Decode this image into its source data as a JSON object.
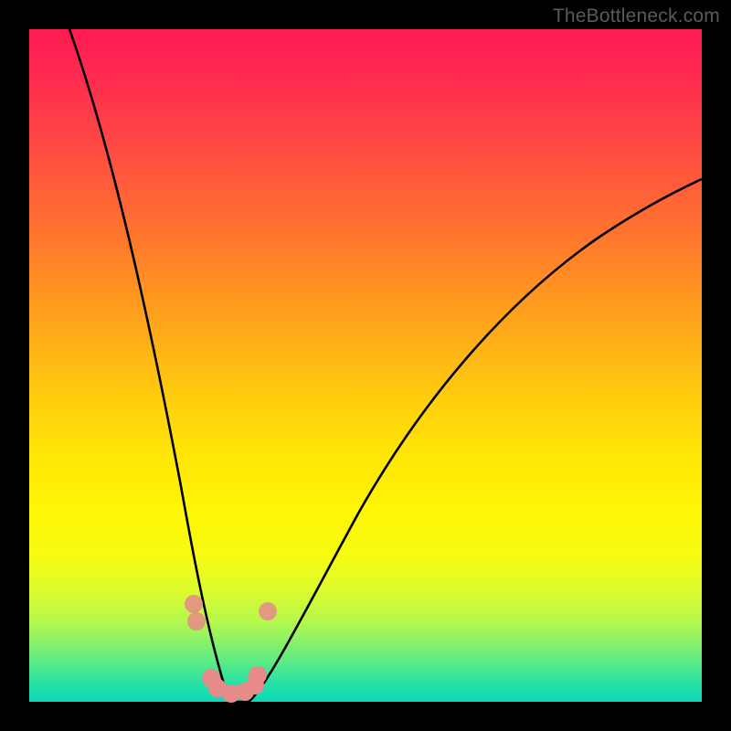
{
  "watermark": "TheBottleneck.com",
  "colors": {
    "background": "#000000",
    "gradient_top": "#ff1a52",
    "gradient_bottom": "#0cd9bb",
    "curve": "#000000",
    "dots": "#e68a8a"
  },
  "chart_data": {
    "type": "line",
    "title": "",
    "xlabel": "",
    "ylabel": "",
    "xlim": [
      0,
      100
    ],
    "ylim": [
      0,
      100
    ],
    "minimum_x": 30,
    "series": [
      {
        "name": "left-branch",
        "x": [
          6,
          10,
          14,
          18,
          22,
          25,
          27,
          29,
          30
        ],
        "y": [
          100,
          80,
          60,
          42,
          26,
          14,
          7,
          2,
          0
        ]
      },
      {
        "name": "right-branch",
        "x": [
          30,
          33,
          38,
          45,
          55,
          65,
          75,
          85,
          95,
          100
        ],
        "y": [
          0,
          2,
          8,
          18,
          32,
          45,
          56,
          66,
          74,
          78
        ]
      }
    ],
    "points": [
      {
        "x_pct": 24.5,
        "y_pct": 85.5
      },
      {
        "x_pct": 24.8,
        "y_pct": 88.0
      },
      {
        "x_pct": 27.0,
        "y_pct": 96.5
      },
      {
        "x_pct": 28.0,
        "y_pct": 98.0
      },
      {
        "x_pct": 30.0,
        "y_pct": 98.8
      },
      {
        "x_pct": 32.0,
        "y_pct": 98.5
      },
      {
        "x_pct": 33.5,
        "y_pct": 97.5
      },
      {
        "x_pct": 34.0,
        "y_pct": 96.0
      },
      {
        "x_pct": 35.5,
        "y_pct": 86.5
      }
    ]
  }
}
